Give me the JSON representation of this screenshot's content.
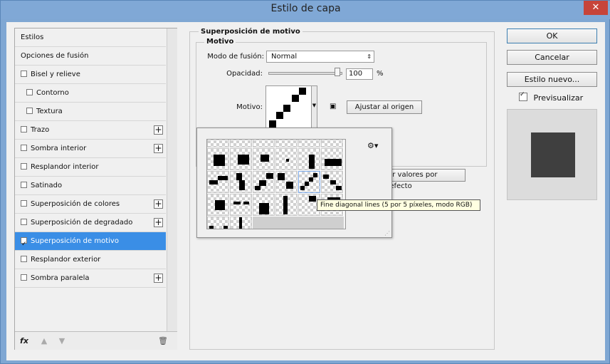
{
  "window": {
    "title": "Estilo de capa",
    "close_icon": "close-icon"
  },
  "sidebar": {
    "items": [
      {
        "label": "Estilos",
        "checkbox": false,
        "plus": false
      },
      {
        "label": "Opciones de fusión",
        "checkbox": false,
        "plus": false
      },
      {
        "label": "Bisel y relieve",
        "checkbox": true,
        "checked": false,
        "plus": false
      },
      {
        "label": "Contorno",
        "checkbox": true,
        "checked": false,
        "plus": false,
        "indent": true
      },
      {
        "label": "Textura",
        "checkbox": true,
        "checked": false,
        "plus": false,
        "indent": true
      },
      {
        "label": "Trazo",
        "checkbox": true,
        "checked": false,
        "plus": true
      },
      {
        "label": "Sombra interior",
        "checkbox": true,
        "checked": false,
        "plus": true
      },
      {
        "label": "Resplandor interior",
        "checkbox": true,
        "checked": false,
        "plus": false
      },
      {
        "label": "Satinado",
        "checkbox": true,
        "checked": false,
        "plus": false
      },
      {
        "label": "Superposición de colores",
        "checkbox": true,
        "checked": false,
        "plus": true
      },
      {
        "label": "Superposición de degradado",
        "checkbox": true,
        "checked": false,
        "plus": true
      },
      {
        "label": "Superposición de motivo",
        "checkbox": true,
        "checked": true,
        "plus": false,
        "selected": true
      },
      {
        "label": "Resplandor exterior",
        "checkbox": true,
        "checked": false,
        "plus": false
      },
      {
        "label": "Sombra paralela",
        "checkbox": true,
        "checked": false,
        "plus": true
      }
    ],
    "bottom": {
      "fx": "fx",
      "up": "▲",
      "down": "▼",
      "trash": "🗑"
    }
  },
  "panel": {
    "group_title": "Superposición de motivo",
    "section_title": "Motivo",
    "blend_label": "Modo de fusión:",
    "blend_value": "Normal",
    "opacity_label": "Opacidad:",
    "opacity_value": "100",
    "opacity_unit": "%",
    "opacity_level": 1.0,
    "pattern_label": "Motivo:",
    "snap_button": "Ajustar al origen",
    "reset_button_partial": "rar valores por defecto",
    "gear_icon": "gear-icon"
  },
  "popup": {
    "tooltip": "Fine diagonal lines (5 por 5 píxeles, modo RGB)"
  },
  "buttons": {
    "ok": "OK",
    "cancel": "Cancelar",
    "new_style": "Estilo nuevo...",
    "preview_label": "Previsualizar",
    "preview_checked": true
  },
  "colors": {
    "accent": "#3a8ee6",
    "window_frame": "#7fa7d3",
    "preview_swatch": "#3f3f3f",
    "close": "#c7443a"
  }
}
